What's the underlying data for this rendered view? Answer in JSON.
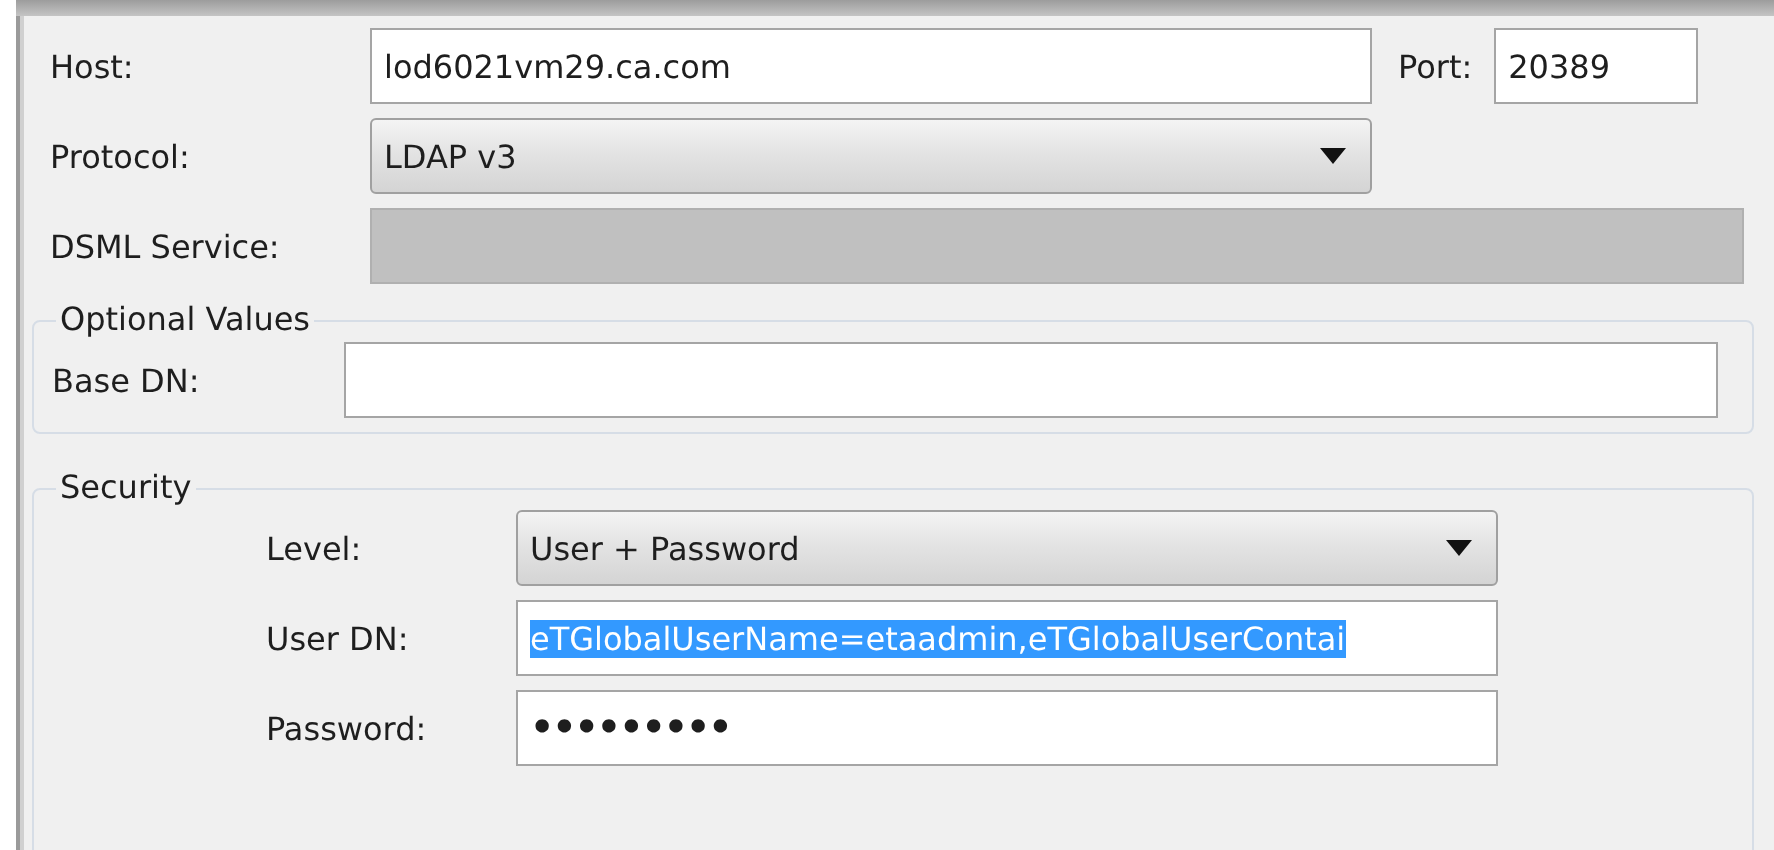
{
  "connection": {
    "host": {
      "label": "Host:",
      "value": "lod6021vm29.ca.com"
    },
    "port": {
      "label": "Port:",
      "value": "20389"
    },
    "protocol": {
      "label": "Protocol:",
      "value": "LDAP v3"
    },
    "dsml_service": {
      "label": "DSML Service:",
      "disabled": true
    }
  },
  "optional_values": {
    "title": "Optional Values",
    "base_dn": {
      "label": "Base DN:"
    }
  },
  "security": {
    "title": "Security",
    "level": {
      "label": "Level:",
      "value": "User + Password"
    },
    "user_dn": {
      "label": "User DN:",
      "value": "eTGlobalUserName=etaadmin,eTGlobalUserContai",
      "text_selected": true
    },
    "password": {
      "label": "Password:",
      "value": "•••••••••"
    }
  }
}
